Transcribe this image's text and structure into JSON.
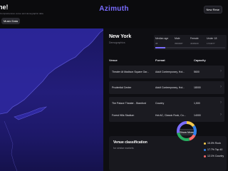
{
  "header": {
    "title": "ne!",
    "subtitle": "Comprehensive venue and demographic data",
    "logo": "Azimuth",
    "new_button": "New Rese",
    "music_button": "Music Data"
  },
  "city": {
    "name": "New York",
    "subtitle": "Demographics"
  },
  "demographics": {
    "columns": [
      {
        "label": "Median age",
        "value": "38"
      },
      {
        "label": "Male",
        "value": "3993087"
      },
      {
        "label": "Female",
        "value": "4348100"
      },
      {
        "label": "Under 18",
        "value": "1734977"
      }
    ]
  },
  "venues": {
    "headers": {
      "venue": "Venue",
      "format": "Format",
      "capacity": "Capacity"
    },
    "rows": [
      {
        "venue": "Theater At Madison Square Gar...",
        "format": "Adult Contemporary, Hot...",
        "capacity": "5600"
      },
      {
        "venue": "Prudential Center",
        "format": "Adult Contemporary, Hot...",
        "capacity": "18000"
      },
      {
        "venue": "The Palace Theater - Stamford",
        "format": "Country",
        "capacity": "1,500"
      },
      {
        "venue": "Forest Hills Stadium",
        "format": "Hot AC, Classic Rock, Co...",
        "capacity": "14000"
      }
    ],
    "show_more": "Show More"
  },
  "classification": {
    "title": "Venue classification",
    "subtitle": "for similar markets",
    "legend": [
      {
        "label": "15.0% Rock",
        "color": "#f2c94c"
      },
      {
        "label": "17.7% Top 40",
        "color": "#2f80ed"
      },
      {
        "label": "12.1% Country",
        "color": "#ff6b6b"
      }
    ]
  },
  "colors": {
    "accent": "#7a6cff",
    "background": "#0b0b0d",
    "map": "#231d7a"
  }
}
